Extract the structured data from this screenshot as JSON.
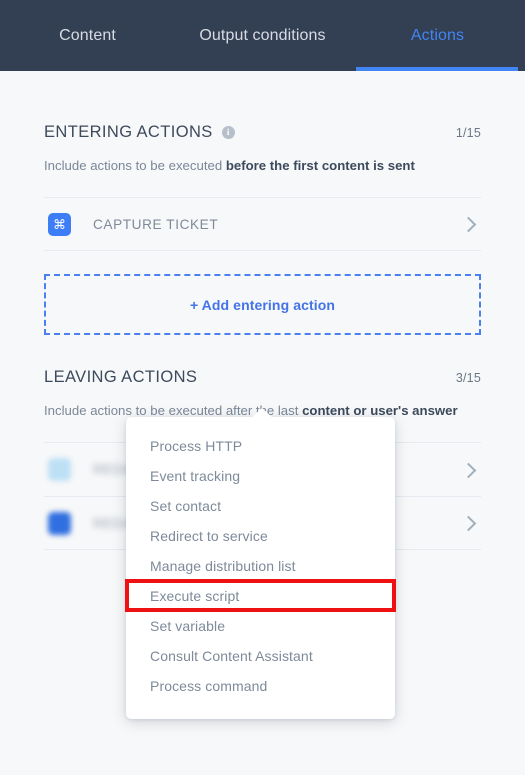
{
  "colors": {
    "header_bg": "#333f52",
    "accent_blue": "#4285f4",
    "page_bg": "#f7f8f9",
    "muted_text": "#7e8a99",
    "dark_text": "#3d4a5c",
    "highlight_red": "#ef1111"
  },
  "tabs": [
    {
      "label": "Content",
      "active": false
    },
    {
      "label": "Output conditions",
      "active": false
    },
    {
      "label": "Actions",
      "active": true
    }
  ],
  "entering_section": {
    "title": "ENTERING ACTIONS",
    "info_icon": "info-icon",
    "counter": "1/15",
    "desc_plain": "Include actions to be executed ",
    "desc_bold": "before the first content is sent",
    "rows": [
      {
        "icon": "command-icon",
        "glyph": "⌘",
        "label": "CAPTURE TICKET",
        "chevron": "chevron-right-icon"
      }
    ],
    "add_button_label": "+ Add entering action"
  },
  "leaving_section": {
    "title": "LEAVING ACTIONS",
    "counter": "3/15",
    "desc_plain": "Include actions to be executed after the last ",
    "desc_bold": "content or user's answer",
    "rows": [
      {
        "icon": "action-icon",
        "glyph": "⌘",
        "label": "REDACTED ACTION",
        "chevron": "chevron-right-icon"
      },
      {
        "icon": "action-icon",
        "glyph": "⌘",
        "label": "REDACTED ACTION",
        "chevron": "chevron-right-icon"
      }
    ]
  },
  "dropdown": {
    "items": [
      {
        "label": "Process HTTP",
        "highlighted": false
      },
      {
        "label": "Event tracking",
        "highlighted": false
      },
      {
        "label": "Set contact",
        "highlighted": false
      },
      {
        "label": "Redirect to service",
        "highlighted": false
      },
      {
        "label": "Manage distribution list",
        "highlighted": false
      },
      {
        "label": "Execute script",
        "highlighted": true
      },
      {
        "label": "Set variable",
        "highlighted": false
      },
      {
        "label": "Consult Content Assistant",
        "highlighted": false
      },
      {
        "label": "Process command",
        "highlighted": false
      }
    ]
  }
}
